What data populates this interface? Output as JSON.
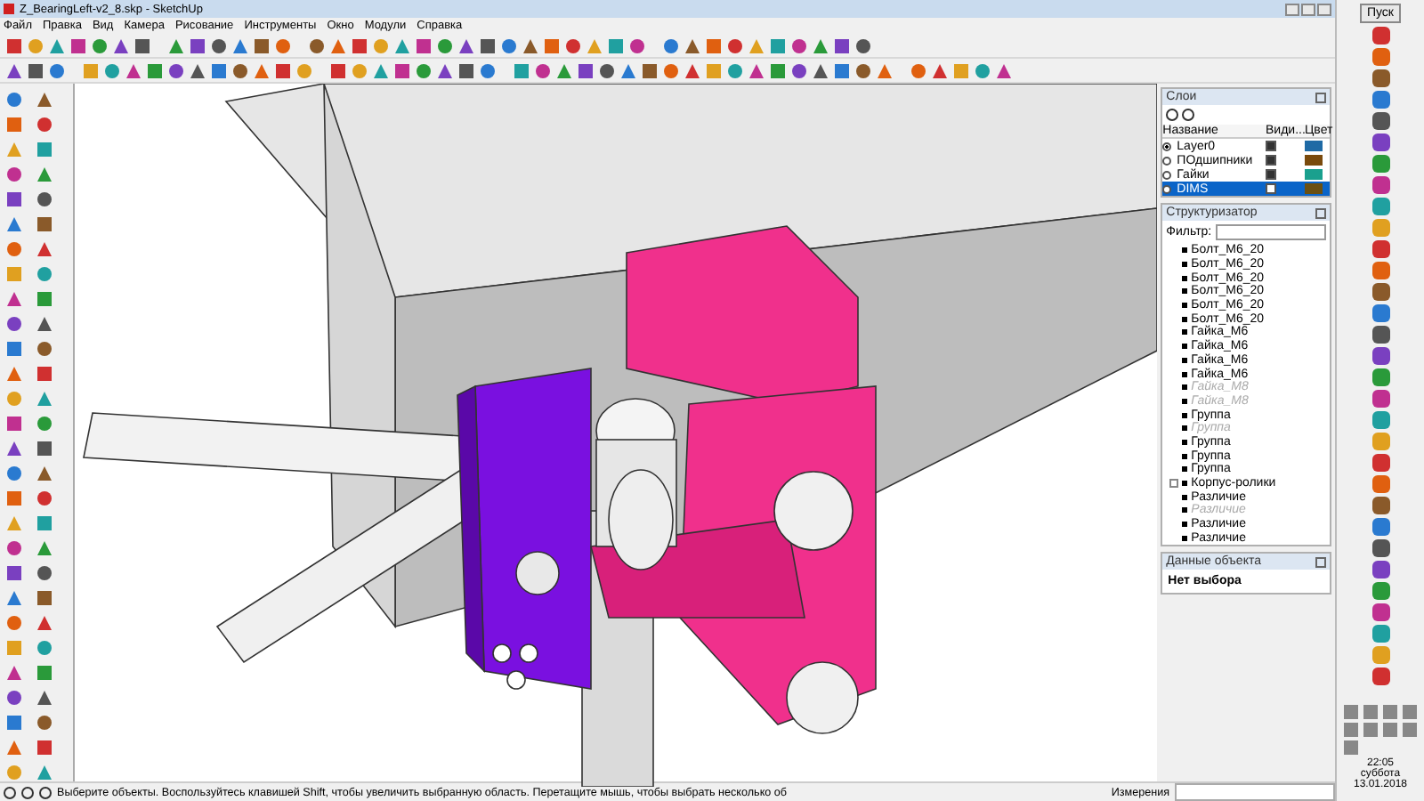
{
  "window": {
    "title": "Z_BearingLeft-v2_8.skp - SketchUp"
  },
  "menu": [
    "Файл",
    "Правка",
    "Вид",
    "Камера",
    "Рисование",
    "Инструменты",
    "Окно",
    "Модули",
    "Справка"
  ],
  "layers_panel": {
    "title": "Слои",
    "columns": [
      "Название",
      "Види...",
      "Цвет"
    ],
    "layers": [
      {
        "name": "Layer0",
        "active": true,
        "visible": true,
        "color": "#1f6aa5",
        "selected": false
      },
      {
        "name": "ПОдшипники",
        "active": false,
        "visible": true,
        "color": "#7a4a0c",
        "selected": false
      },
      {
        "name": "Гайки",
        "active": false,
        "visible": true,
        "color": "#1aa08e",
        "selected": false
      },
      {
        "name": "DIMS",
        "active": false,
        "visible": false,
        "color": "#6b5012",
        "selected": true
      }
    ]
  },
  "outliner": {
    "title": "Структуризатор",
    "filter_label": "Фильтр:",
    "items": [
      {
        "name": "Болт_M6_20",
        "hidden": false,
        "kind": "leaf"
      },
      {
        "name": "Болт_M6_20",
        "hidden": false,
        "kind": "leaf"
      },
      {
        "name": "Болт_M6_20",
        "hidden": false,
        "kind": "leaf"
      },
      {
        "name": "Болт_M6_20",
        "hidden": false,
        "kind": "leaf"
      },
      {
        "name": "Болт_M6_20",
        "hidden": false,
        "kind": "leaf"
      },
      {
        "name": "Болт_M6_20",
        "hidden": false,
        "kind": "leaf"
      },
      {
        "name": "Гайка_M6",
        "hidden": false,
        "kind": "leaf"
      },
      {
        "name": "Гайка_M6",
        "hidden": false,
        "kind": "leaf"
      },
      {
        "name": "Гайка_M6",
        "hidden": false,
        "kind": "leaf"
      },
      {
        "name": "Гайка_M6",
        "hidden": false,
        "kind": "leaf"
      },
      {
        "name": "Гайка_M8",
        "hidden": true,
        "kind": "leaf"
      },
      {
        "name": "Гайка_M8",
        "hidden": true,
        "kind": "leaf"
      },
      {
        "name": "Группа",
        "hidden": false,
        "kind": "leaf"
      },
      {
        "name": "Группа",
        "hidden": true,
        "kind": "leaf"
      },
      {
        "name": "Группа",
        "hidden": false,
        "kind": "leaf"
      },
      {
        "name": "Группа",
        "hidden": false,
        "kind": "leaf"
      },
      {
        "name": "Группа",
        "hidden": false,
        "kind": "leaf"
      },
      {
        "name": "Корпус-ролики",
        "hidden": false,
        "kind": "collapsed"
      },
      {
        "name": "Различие",
        "hidden": false,
        "kind": "leaf"
      },
      {
        "name": "Различие",
        "hidden": true,
        "kind": "leaf"
      },
      {
        "name": "Различие",
        "hidden": false,
        "kind": "leaf"
      },
      {
        "name": "Различие",
        "hidden": false,
        "kind": "leaf"
      }
    ]
  },
  "entity_info": {
    "title": "Данные объекта",
    "text": "Нет выбора"
  },
  "status_bar": {
    "hint": "Выберите объекты. Воспользуйтесь клавишей Shift, чтобы увеличить выбранную область. Перетащите мышь, чтобы выбрать несколько об",
    "measurements_label": "Измерения"
  },
  "taskbar": {
    "start": "Пуск",
    "time": "22:05",
    "weekday": "суббота",
    "date": "13.01.2018"
  }
}
